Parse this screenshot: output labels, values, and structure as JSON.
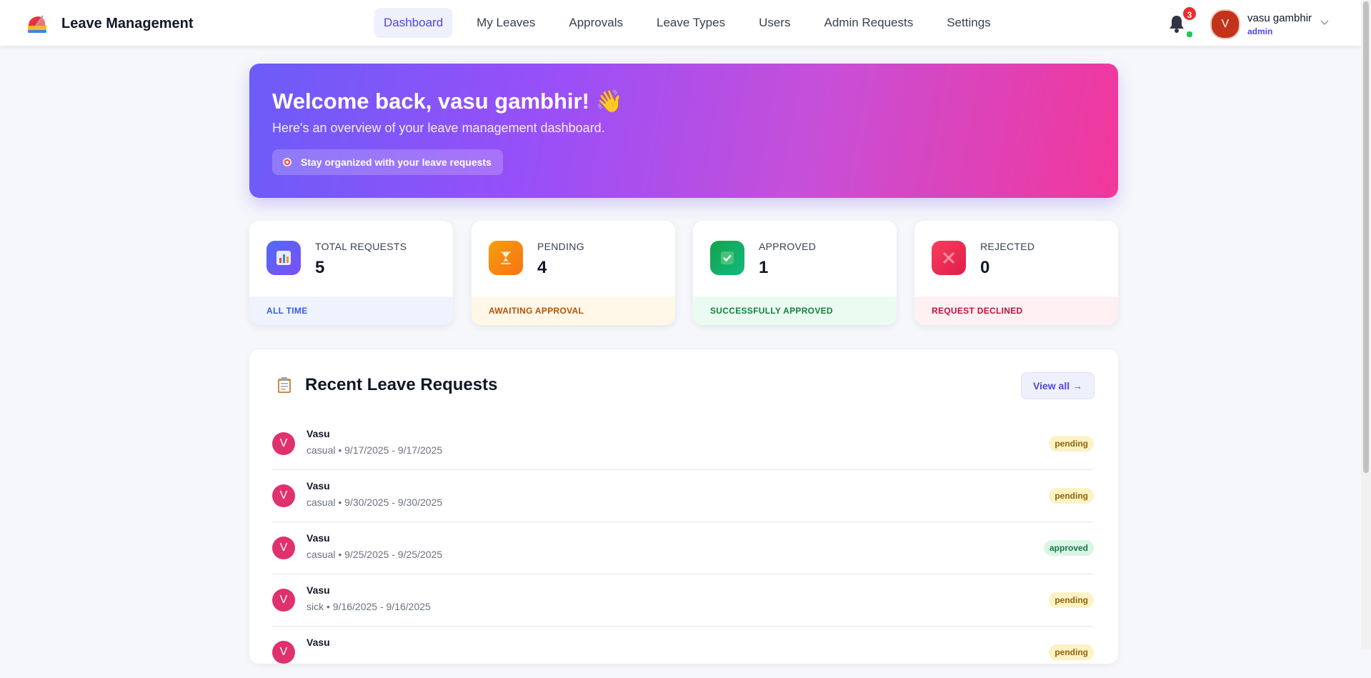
{
  "brand": {
    "title": "Leave Management"
  },
  "nav": [
    {
      "label": "Dashboard",
      "active": true
    },
    {
      "label": "My Leaves"
    },
    {
      "label": "Approvals"
    },
    {
      "label": "Leave Types"
    },
    {
      "label": "Users"
    },
    {
      "label": "Admin Requests"
    },
    {
      "label": "Settings"
    }
  ],
  "notifications": {
    "count": "3"
  },
  "user": {
    "initial": "V",
    "name": "vasu gambhir",
    "role": "admin"
  },
  "hero": {
    "title": "Welcome back, vasu gambhir! 👋",
    "subtitle": "Here's an overview of your leave management dashboard.",
    "pill": "Stay organized with your leave requests"
  },
  "stats": [
    {
      "label": "TOTAL REQUESTS",
      "value": "5",
      "footer": "ALL TIME",
      "icon": "chart-icon"
    },
    {
      "label": "PENDING",
      "value": "4",
      "footer": "AWAITING APPROVAL",
      "icon": "hourglass-icon"
    },
    {
      "label": "APPROVED",
      "value": "1",
      "footer": "SUCCESSFULLY APPROVED",
      "icon": "check-icon"
    },
    {
      "label": "REJECTED",
      "value": "0",
      "footer": "REQUEST DECLINED",
      "icon": "x-icon"
    }
  ],
  "colors": {
    "accent": "#4f46e5",
    "total": "#4f6bf5",
    "pending": "#f59e0b",
    "approved": "#16a34a",
    "rejected": "#e11d48"
  },
  "recent": {
    "title": "Recent Leave Requests",
    "view_all": "View all →",
    "items": [
      {
        "initial": "V",
        "name": "Vasu",
        "meta": "casual • 9/17/2025 - 9/17/2025",
        "status": "pending"
      },
      {
        "initial": "V",
        "name": "Vasu",
        "meta": "casual • 9/30/2025 - 9/30/2025",
        "status": "pending"
      },
      {
        "initial": "V",
        "name": "Vasu",
        "meta": "casual • 9/25/2025 - 9/25/2025",
        "status": "approved"
      },
      {
        "initial": "V",
        "name": "Vasu",
        "meta": "sick • 9/16/2025 - 9/16/2025",
        "status": "pending"
      },
      {
        "initial": "V",
        "name": "Vasu",
        "meta": "",
        "status": "pending"
      }
    ]
  }
}
